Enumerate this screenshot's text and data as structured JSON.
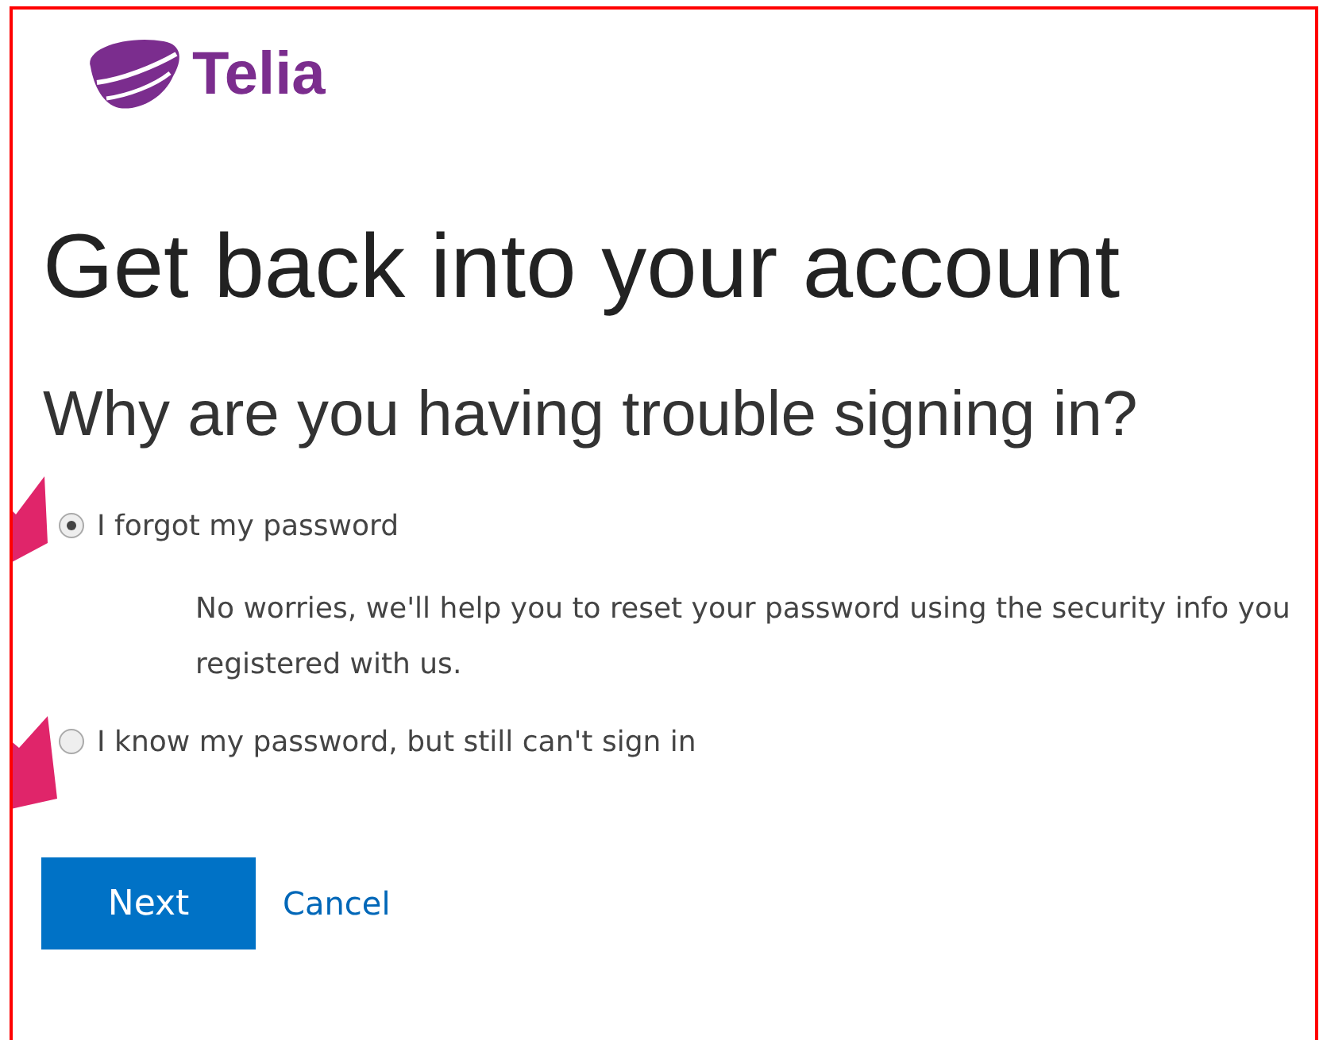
{
  "logo": {
    "text": "Telia"
  },
  "title": "Get back into your account",
  "subtitle": "Why are you having trouble signing in?",
  "options": [
    {
      "label": "I forgot my password",
      "selected": true,
      "description": "No worries, we'll help you to reset your password using the security info you registered with us."
    },
    {
      "label": "I know my password, but still can't sign in",
      "selected": false
    }
  ],
  "buttons": {
    "primary": "Next",
    "link": "Cancel"
  }
}
